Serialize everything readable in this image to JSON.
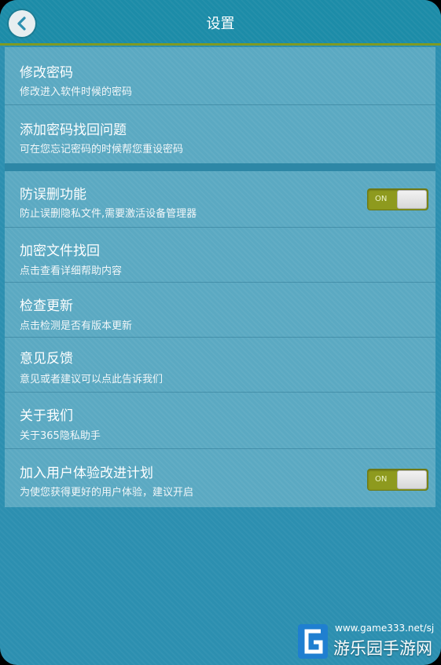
{
  "header": {
    "title": "设置",
    "back_icon": "back-arrow-icon"
  },
  "account_section": {
    "items": [
      {
        "title": "修改密码",
        "subtitle": "修改进入软件时候的密码"
      },
      {
        "title": "添加密码找回问题",
        "subtitle": "可在您忘记密码的时候帮您重设密码"
      }
    ]
  },
  "general_section": {
    "items": [
      {
        "title": "防误删功能",
        "subtitle": "防止误删隐私文件,需要激活设备管理器",
        "toggle": "ON"
      },
      {
        "title": "加密文件找回",
        "subtitle": "点击查看详细帮助内容"
      },
      {
        "title": "检查更新",
        "subtitle": "点击检测是否有版本更新"
      },
      {
        "title": "意见反馈",
        "subtitle": "意见或者建议可以点此告诉我们"
      },
      {
        "title": "关于我们",
        "subtitle": "关于365隐私助手"
      },
      {
        "title": "加入用户体验改进计划",
        "subtitle": "为使您获得更好的用户体验，建议开启",
        "toggle": "ON"
      }
    ]
  },
  "watermark": {
    "url": "www.game333.net/sj",
    "name": "游乐园手游网"
  },
  "colors": {
    "background": "#2c8fb0",
    "panel": "#5ba9c2",
    "toggle_on": "#8e9a1e",
    "title_underline": "#7f9a22"
  }
}
